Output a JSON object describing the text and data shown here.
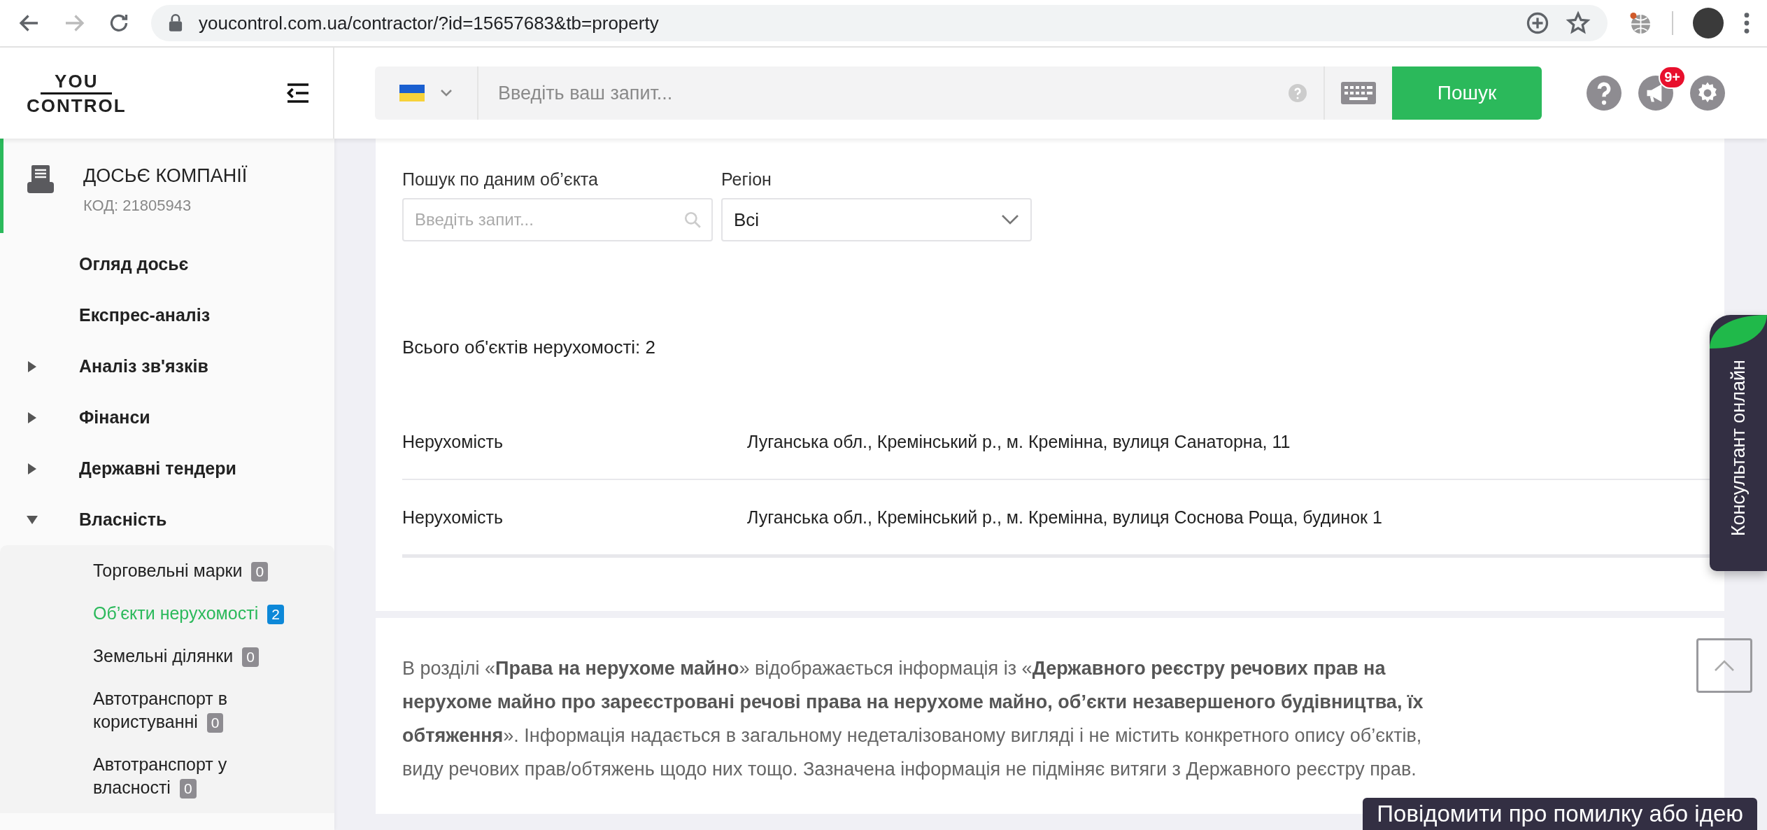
{
  "browser": {
    "url": "youcontrol.com.ua/contractor/?id=15657683&tb=property"
  },
  "header": {
    "logo": {
      "line_1": "YOU",
      "line_2": "CONTROL"
    },
    "search_placeholder": "Введіть ваш запит...",
    "search_button": "Пошук",
    "notification_badge": "9+"
  },
  "sidebar": {
    "title": "ДОСЬЄ КОМПАНІЇ",
    "code": "КОД: 21805943",
    "items": [
      {
        "kind": "link",
        "label": "Огляд досьє"
      },
      {
        "kind": "link",
        "label": "Експрес-аналіз"
      },
      {
        "kind": "group",
        "label": "Аналіз зв'язків",
        "expanded": false
      },
      {
        "kind": "group",
        "label": "Фінанси",
        "expanded": false
      },
      {
        "kind": "group",
        "label": "Державні тендери",
        "expanded": false
      },
      {
        "kind": "group",
        "label": "Власність",
        "expanded": true,
        "children": [
          {
            "label": "Торговельні марки",
            "count": "0",
            "selected": false
          },
          {
            "label": "Об’єкти нерухомості",
            "count": "2",
            "selected": true
          },
          {
            "label": "Земельні ділянки",
            "count": "0",
            "selected": false
          },
          {
            "label": "Автотранспорт в користуванні",
            "count": "0",
            "selected": false
          },
          {
            "label": "Автотранспорт у власності",
            "count": "0",
            "selected": false
          }
        ]
      }
    ]
  },
  "filters": {
    "search": {
      "label": "Пошук по даним об’єкта",
      "placeholder": "Введіть запит..."
    },
    "region": {
      "label": "Регіон",
      "value": "Всі"
    }
  },
  "total": "Всього об'єктів нерухомості: 2",
  "table": {
    "rows": [
      {
        "type": "Нерухомість",
        "address": "Луганська обл., Кремінський р., м. Кремінна, вулиця Санаторна, 11"
      },
      {
        "type": "Нерухомість",
        "address": "Луганська обл., Кремінський р., м. Кремінна, вулиця Соснова Роща, будинок 1"
      }
    ]
  },
  "info": "В розділі «**Права на нерухоме майно**» відображається інформація із «**Державного реєстру речових прав на нерухоме майно про зареєстровані речові права на нерухоме майно, об’єкти незавершеного будівництва, їх обтяження**». Інформація надається в загальному недеталізованому вигляді і не містить конкретного опису об’єктів, виду речових прав/обтяжень щодо них тощо. Зазначена інформація не підміняє витяги з Державного реєстру прав.",
  "consultant_tab": "Консультант онлайн",
  "feedback_button": "Повідомити про помилку або ідею"
}
